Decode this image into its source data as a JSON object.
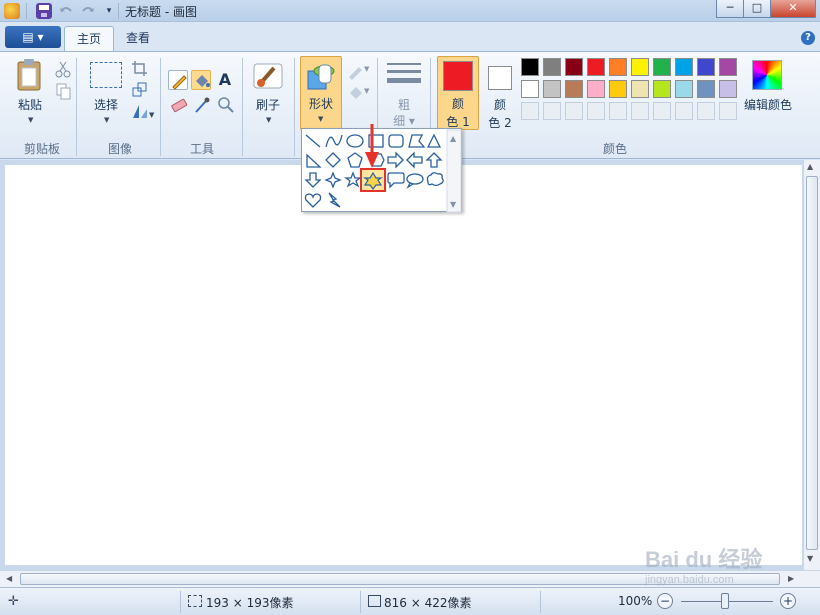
{
  "window": {
    "title": "无标题 - 画图",
    "minimize_label": "─",
    "maximize_label": "□",
    "close_label": "✕"
  },
  "ribbon_tabs": {
    "app_menu_label": "▤ ▾",
    "home": "主页",
    "view": "查看",
    "help": "?"
  },
  "groups": {
    "clipboard": {
      "label": "剪贴板",
      "paste": "粘贴"
    },
    "image": {
      "label": "图像",
      "select": "选择"
    },
    "tools": {
      "label": "工具"
    },
    "brushes": {
      "label": "刷子"
    },
    "shapes": {
      "label": "形状"
    },
    "size": {
      "label_line1": "粗",
      "label_line2": "细"
    },
    "color1": {
      "line1": "颜",
      "line2": "色 1",
      "value": "#ed1c24"
    },
    "color2": {
      "line1": "颜",
      "line2": "色 2",
      "value": "#ffffff"
    },
    "colors": {
      "label": "颜色",
      "edit": "编辑颜色"
    }
  },
  "palette": {
    "row1": [
      "#000000",
      "#7f7f7f",
      "#880015",
      "#ed1c24",
      "#ff7f27",
      "#fff200",
      "#22b14c",
      "#00a2e8",
      "#3f48cc",
      "#a349a4"
    ],
    "row2": [
      "#ffffff",
      "#c3c3c3",
      "#b97a57",
      "#ffaec9",
      "#ffc90e",
      "#efe4b0",
      "#b5e61d",
      "#99d9ea",
      "#7092be",
      "#c8bfe7"
    ]
  },
  "shapes_popup": {
    "selected_shape": "six-point-star",
    "icons": [
      "line",
      "curve",
      "oval",
      "rectangle",
      "rounded-rectangle",
      "polygon",
      "triangle",
      "right-triangle",
      "diamond",
      "pentagon",
      "hexagon",
      "right-arrow",
      "left-arrow",
      "up-arrow",
      "down-arrow",
      "four-point-star",
      "five-point-star",
      "six-point-star",
      "rounded-callout",
      "oval-callout",
      "cloud-callout",
      "heart",
      "lightning"
    ]
  },
  "status": {
    "selection_size": "193 × 193像素",
    "image_size": "816 × 422像素",
    "zoom": "100%",
    "zoom_out": "−",
    "zoom_in": "+"
  },
  "watermark": {
    "line1": "Bai du 经验",
    "line2": "jingyan.baidu.com"
  },
  "accent_colors": {
    "highlight": "#e5332b",
    "selected_tab_bg": "#fbd68b"
  }
}
